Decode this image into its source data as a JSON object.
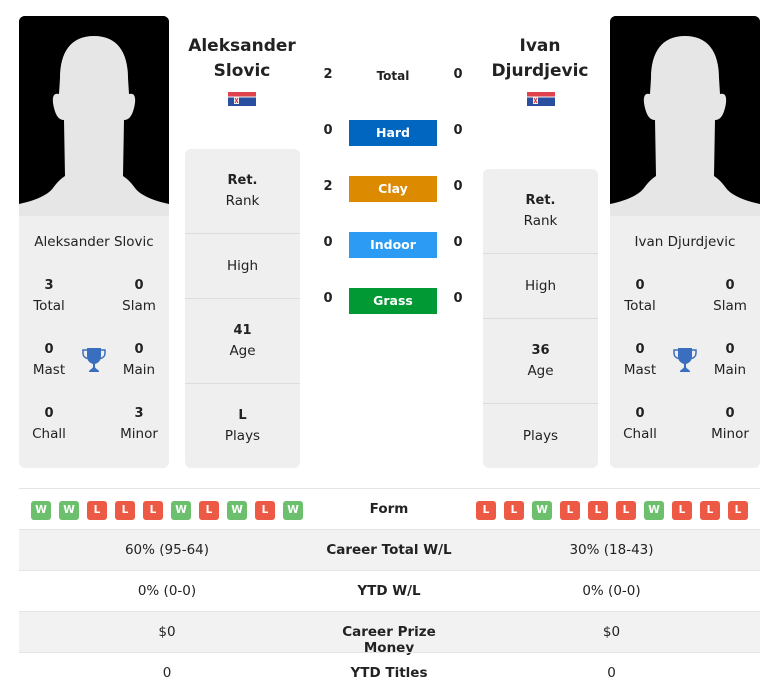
{
  "colors": {
    "hard": "#0066c0",
    "clay": "#dc8a00",
    "indoor": "#2b9bf4",
    "grass": "#009933",
    "win": "#6cbf6c",
    "loss": "#ec5a45",
    "trophy": "#3a6fbf"
  },
  "player1": {
    "name_line1": "Aleksander",
    "name_line2": "Slovic",
    "full_name": "Aleksander Slovic",
    "flag": "serbia-flag",
    "titles": {
      "total": {
        "value": "3",
        "label": "Total"
      },
      "slam": {
        "value": "0",
        "label": "Slam"
      },
      "mast": {
        "value": "0",
        "label": "Mast"
      },
      "main": {
        "value": "0",
        "label": "Main"
      },
      "chall": {
        "value": "0",
        "label": "Chall"
      },
      "minor": {
        "value": "3",
        "label": "Minor"
      }
    },
    "info": {
      "rank": {
        "value": "Ret.",
        "label": "Rank"
      },
      "high": {
        "value": "",
        "label": "High"
      },
      "age": {
        "value": "41",
        "label": "Age"
      },
      "plays": {
        "value": "L",
        "label": "Plays"
      }
    },
    "form": [
      "W",
      "W",
      "L",
      "L",
      "L",
      "W",
      "L",
      "W",
      "L",
      "W"
    ]
  },
  "player2": {
    "name_line1": "Ivan",
    "name_line2": "Djurdjevic",
    "full_name": "Ivan Djurdjevic",
    "flag": "serbia-flag",
    "titles": {
      "total": {
        "value": "0",
        "label": "Total"
      },
      "slam": {
        "value": "0",
        "label": "Slam"
      },
      "mast": {
        "value": "0",
        "label": "Mast"
      },
      "main": {
        "value": "0",
        "label": "Main"
      },
      "chall": {
        "value": "0",
        "label": "Chall"
      },
      "minor": {
        "value": "0",
        "label": "Minor"
      }
    },
    "info": {
      "rank": {
        "value": "Ret.",
        "label": "Rank"
      },
      "high": {
        "value": "",
        "label": "High"
      },
      "age": {
        "value": "36",
        "label": "Age"
      },
      "plays": {
        "value": "",
        "label": "Plays"
      }
    },
    "form": [
      "L",
      "L",
      "W",
      "L",
      "L",
      "L",
      "W",
      "L",
      "L",
      "L"
    ]
  },
  "h2h": {
    "total": {
      "label": "Total",
      "p1": "2",
      "p2": "0"
    },
    "surfaces": [
      {
        "key": "hard",
        "label": "Hard",
        "p1": "0",
        "p2": "0"
      },
      {
        "key": "clay",
        "label": "Clay",
        "p1": "2",
        "p2": "0"
      },
      {
        "key": "indoor",
        "label": "Indoor",
        "p1": "0",
        "p2": "0"
      },
      {
        "key": "grass",
        "label": "Grass",
        "p1": "0",
        "p2": "0"
      }
    ]
  },
  "comparison": {
    "form_label": "Form",
    "rows": [
      {
        "label": "Career Total W/L",
        "p1": "60% (95-64)",
        "p2": "30% (18-43)"
      },
      {
        "label": "YTD W/L",
        "p1": "0% (0-0)",
        "p2": "0% (0-0)"
      },
      {
        "label": "Career Prize Money",
        "p1": "$0",
        "p2": "$0"
      },
      {
        "label": "YTD Titles",
        "p1": "0",
        "p2": "0"
      }
    ]
  }
}
